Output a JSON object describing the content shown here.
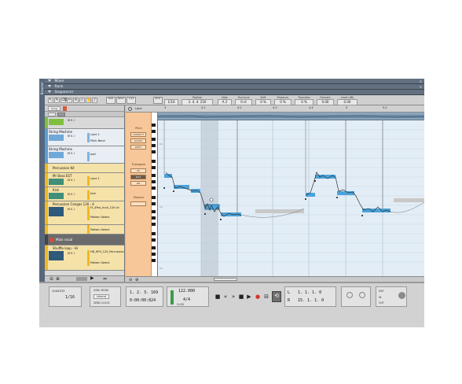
{
  "sections": {
    "browser": "Browser",
    "mixer": "Mixer",
    "rack": "Rack",
    "sequencer": "Sequencer"
  },
  "toolbar": {
    "snap_buttons": [
      "BAR",
      "BEAT",
      "1/16",
      "EDIT"
    ],
    "grid_value": "1/16",
    "fields": [
      {
        "label": "Position",
        "value": "3. 4. 4. 216"
      },
      {
        "label": "Note",
        "value": "A 2"
      },
      {
        "label": "Fine-tune",
        "value": "0 ct"
      },
      {
        "label": "Drift",
        "value": "0 %"
      },
      {
        "label": "Presence",
        "value": "0 %"
      },
      {
        "label": "Transition",
        "value": "0 %"
      },
      {
        "label": "Formant",
        "value": "0.00"
      },
      {
        "label": "Level (dB)",
        "value": "0.00"
      }
    ]
  },
  "track_list": {
    "header_label": "Song",
    "tracks": [
      {
        "name": "",
        "sub": "",
        "sub2": "",
        "color": "#7fbf3f"
      },
      {
        "name": "String Machine",
        "sub": "Lane 1",
        "sub2": "Pitch Bend",
        "color": "#5c9fd6"
      },
      {
        "name": "String Machine",
        "sub": "pad",
        "sub2": "",
        "color": "#5c9fd6"
      },
      {
        "name": "Percussion Kit",
        "sub": "",
        "sub2": "",
        "color": "#f0b820"
      },
      {
        "name": "Mr Bass EST",
        "sub": "Lane 1",
        "sub2": "",
        "color": "#f0b820"
      },
      {
        "name": "Kick",
        "sub": "kick",
        "sub2": "",
        "color": "#f0b820"
      },
      {
        "name": "Percussion Congas 120 - 4",
        "sub": "Ft_4Pos_funk_120 cd",
        "sub2": "Pattern Select",
        "color": "#f0b820"
      },
      {
        "name": "Kick",
        "sub": "",
        "sub2": "Pattern Select",
        "color": "#f0b820"
      },
      {
        "name": "Main vocal",
        "sub": "",
        "sub2": "",
        "color": "#555555"
      },
      {
        "name": "Shuffle loop - Hi",
        "sub": "HB_HFH_120_Percussion",
        "sub2": "Pattern Select",
        "color": "#f0b820"
      }
    ]
  },
  "editor": {
    "lane_label": "Lane",
    "ruler": [
      "3",
      "4.1",
      "4.2",
      "4.3",
      "4.4",
      "5",
      "5.2"
    ],
    "side_caption": "Pitch",
    "side_buttons": [
      "CORRECT",
      "QUANT",
      "DRIFT"
    ],
    "transpose_label": "Transpose",
    "transpose_buttons": [
      "UP",
      "OCT",
      "DN"
    ],
    "monitor_label": "Monitor",
    "key_labels": [
      "C4",
      "C3",
      "C2"
    ]
  },
  "transport": {
    "quantize_label": "QUANTIZE",
    "grid_label": "1/16",
    "sync_label": "SYNC MODE",
    "sync_value": "Internal",
    "sync_sub": "SEND CLOCK",
    "position": "1. 2. 3. 169",
    "time": "0:00:00:824",
    "tempo": "122.000",
    "signature": "4/4",
    "tempo_sub": "CLICK",
    "loop_l": "1. 1. 1. 0",
    "loop_r": "15. 1. 1. 0",
    "l_label": "L",
    "r_label": "R",
    "dsp_label": "DSP",
    "in_label": "IN",
    "out_label": "OUT"
  }
}
